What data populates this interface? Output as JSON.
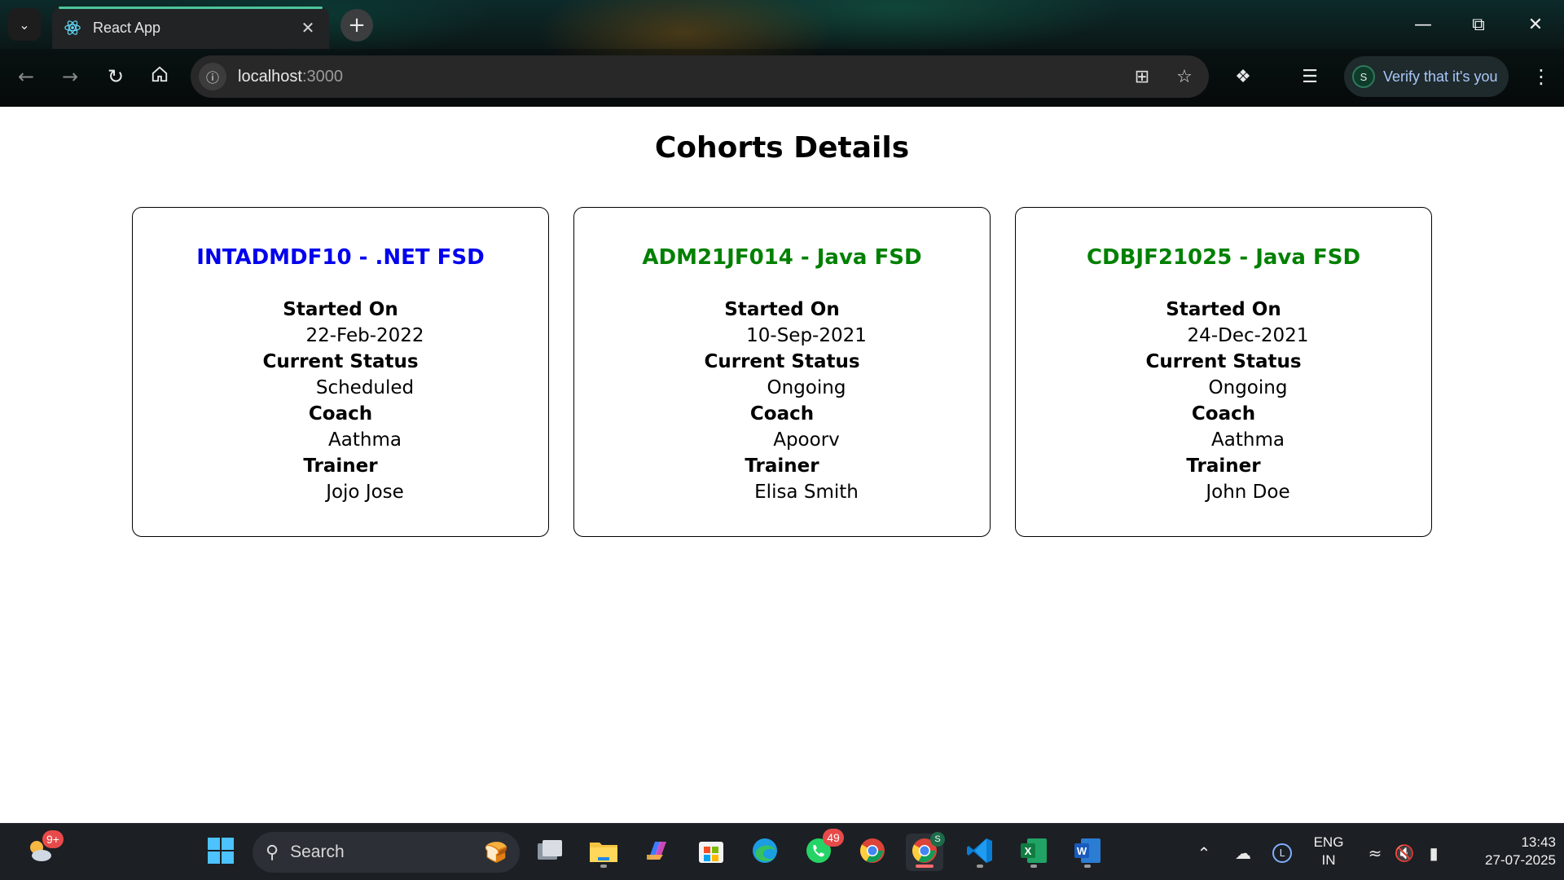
{
  "browser": {
    "tab_title": "React App",
    "url_host": "localhost",
    "url_port": ":3000",
    "profile_initial": "S",
    "verify_text": "Verify that it's you"
  },
  "page": {
    "title": "Cohorts Details",
    "cohorts": [
      {
        "code_title": "INTADMDF10 - .NET FSD",
        "title_color": "#0000ee",
        "started_on_label": "Started On",
        "started_on": "22-Feb-2022",
        "status_label": "Current Status",
        "status": "Scheduled",
        "coach_label": "Coach",
        "coach": "Aathma",
        "trainer_label": "Trainer",
        "trainer": "Jojo Jose"
      },
      {
        "code_title": "ADM21JF014 - Java FSD",
        "title_color": "#008000",
        "started_on_label": "Started On",
        "started_on": "10-Sep-2021",
        "status_label": "Current Status",
        "status": "Ongoing",
        "coach_label": "Coach",
        "coach": "Apoorv",
        "trainer_label": "Trainer",
        "trainer": "Elisa Smith"
      },
      {
        "code_title": "CDBJF21025 - Java FSD",
        "title_color": "#008000",
        "started_on_label": "Started On",
        "started_on": "24-Dec-2021",
        "status_label": "Current Status",
        "status": "Ongoing",
        "coach_label": "Coach",
        "coach": "Aathma",
        "trainer_label": "Trainer",
        "trainer": "John Doe"
      }
    ]
  },
  "taskbar": {
    "weather_badge": "9+",
    "search_placeholder": "Search",
    "whatsapp_badge": "49",
    "chrome_profile_badge": "S",
    "language_line1": "ENG",
    "language_line2": "IN",
    "onedrive_initial": "L",
    "time": "13:43",
    "date": "27-07-2025"
  }
}
